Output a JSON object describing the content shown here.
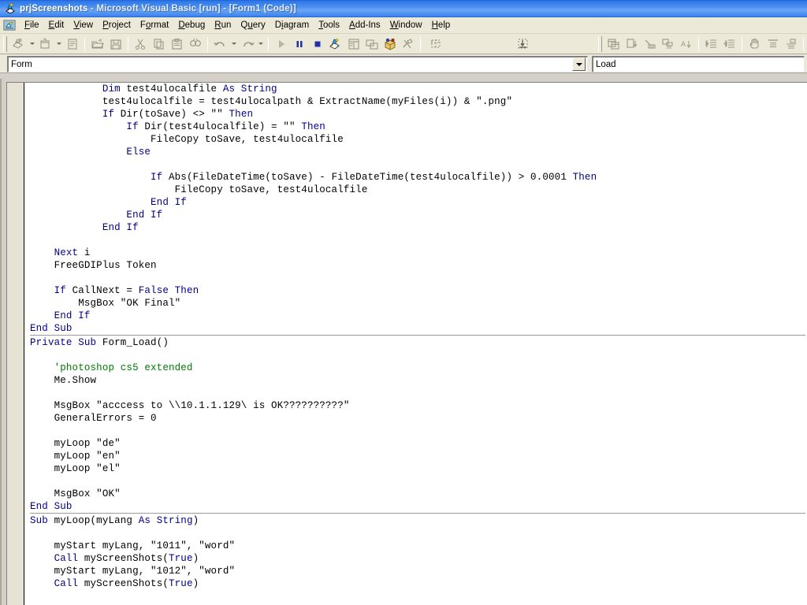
{
  "window": {
    "title_bold": "prjScreenshots",
    "title_rest": " - Microsoft Visual Basic [run] - [Form1 (Code)]",
    "app_icon": "vb-project-icon",
    "titlebar_color": "#3e86ee",
    "chrome_color": "#ece9d8"
  },
  "menu": {
    "doc_icon": "vb-document-icon",
    "items": [
      {
        "label": "File",
        "accel": "F"
      },
      {
        "label": "Edit",
        "accel": "E"
      },
      {
        "label": "View",
        "accel": "V"
      },
      {
        "label": "Project",
        "accel": "P"
      },
      {
        "label": "Format",
        "accel": "o"
      },
      {
        "label": "Debug",
        "accel": "D"
      },
      {
        "label": "Run",
        "accel": "R"
      },
      {
        "label": "Query",
        "accel": "u"
      },
      {
        "label": "Diagram",
        "accel": "i"
      },
      {
        "label": "Tools",
        "accel": "T"
      },
      {
        "label": "Add-Ins",
        "accel": "A"
      },
      {
        "label": "Window",
        "accel": "W"
      },
      {
        "label": "Help",
        "accel": "H"
      }
    ]
  },
  "toolbar": {
    "buttons": [
      {
        "name": "add-project-icon",
        "tip": "Add Project",
        "enabled": false,
        "split": true
      },
      {
        "name": "add-form-icon",
        "tip": "Add Form",
        "enabled": false,
        "split": true
      },
      {
        "name": "menu-editor-icon",
        "tip": "Menu Editor",
        "enabled": false,
        "split": false
      },
      {
        "name": "open-project-icon",
        "tip": "Open Project",
        "enabled": false,
        "split": false
      },
      {
        "name": "save-project-icon",
        "tip": "Save Project",
        "enabled": false,
        "split": false
      },
      {
        "name": "cut-icon",
        "tip": "Cut",
        "enabled": false,
        "split": false
      },
      {
        "name": "copy-icon",
        "tip": "Copy",
        "enabled": false,
        "split": false
      },
      {
        "name": "paste-icon",
        "tip": "Paste",
        "enabled": false,
        "split": false
      },
      {
        "name": "find-icon",
        "tip": "Find",
        "enabled": false,
        "split": false
      },
      {
        "name": "undo-icon",
        "tip": "Undo",
        "enabled": false,
        "split": false
      },
      {
        "name": "redo-icon",
        "tip": "Redo",
        "enabled": false,
        "split": false
      },
      {
        "name": "start-icon",
        "tip": "Start",
        "enabled": false,
        "split": false
      },
      {
        "name": "break-icon",
        "tip": "Break",
        "enabled": true,
        "split": false
      },
      {
        "name": "end-icon",
        "tip": "End",
        "enabled": true,
        "split": false
      },
      {
        "name": "project-explorer-icon",
        "tip": "Project Explorer",
        "enabled": true,
        "split": false
      },
      {
        "name": "properties-window-icon",
        "tip": "Properties Window",
        "enabled": false,
        "split": false
      },
      {
        "name": "form-layout-icon",
        "tip": "Form Layout Window",
        "enabled": false,
        "split": false
      },
      {
        "name": "object-browser-icon",
        "tip": "Object Browser",
        "enabled": true,
        "split": false
      },
      {
        "name": "toolbox-icon",
        "tip": "Toolbox",
        "enabled": true,
        "split": false
      },
      {
        "name": "data-view-icon",
        "tip": "Data View Window",
        "enabled": false,
        "split": false
      },
      {
        "name": "visual-component-icon",
        "tip": "Visual Component Manager",
        "enabled": false,
        "split": false
      }
    ],
    "right_buttons": [
      {
        "name": "new-query-icon",
        "tip": "New Query"
      },
      {
        "name": "run-query-icon",
        "tip": "Run Query"
      },
      {
        "name": "verify-sql-icon",
        "tip": "Verify SQL Syntax"
      },
      {
        "name": "group-by-icon",
        "tip": "Group By"
      },
      {
        "name": "sort-asc-icon",
        "tip": "Sort Ascending"
      },
      {
        "name": "indent-icon",
        "tip": "Indent"
      },
      {
        "name": "outdent-icon",
        "tip": "Outdent"
      },
      {
        "name": "hand-icon",
        "tip": "Pan"
      },
      {
        "name": "align-left-icon",
        "tip": "Align Left"
      },
      {
        "name": "align-top-icon",
        "tip": "Align Top"
      }
    ],
    "progress_indicator": "progress-markers"
  },
  "combos": {
    "object": {
      "value": "Form",
      "dropdown_icon": "chevron-down-icon"
    },
    "procedure": {
      "value": "Load"
    }
  },
  "code": {
    "lines": [
      {
        "indent": 12,
        "segments": [
          {
            "t": "Dim ",
            "c": "kw"
          },
          {
            "t": "test4ulocalfile "
          },
          {
            "t": "As String",
            "c": "kw"
          }
        ]
      },
      {
        "indent": 12,
        "segments": [
          {
            "t": "test4ulocalfile = test4ulocalpath & ExtractName(myFiles(i)) & \".png\""
          }
        ]
      },
      {
        "indent": 12,
        "segments": [
          {
            "t": "If ",
            "c": "kw"
          },
          {
            "t": "Dir(toSave) <> \"\" "
          },
          {
            "t": "Then",
            "c": "kw"
          }
        ]
      },
      {
        "indent": 16,
        "segments": [
          {
            "t": "If ",
            "c": "kw"
          },
          {
            "t": "Dir(test4ulocalfile) = \"\" "
          },
          {
            "t": "Then",
            "c": "kw"
          }
        ]
      },
      {
        "indent": 20,
        "segments": [
          {
            "t": "FileCopy toSave, test4ulocalfile"
          }
        ]
      },
      {
        "indent": 16,
        "segments": [
          {
            "t": "Else",
            "c": "kw"
          }
        ]
      },
      {
        "indent": 0,
        "segments": []
      },
      {
        "indent": 20,
        "segments": [
          {
            "t": "If ",
            "c": "kw"
          },
          {
            "t": "Abs(FileDateTime(toSave) - FileDateTime(test4ulocalfile)) > 0.0001 "
          },
          {
            "t": "Then",
            "c": "kw"
          }
        ]
      },
      {
        "indent": 24,
        "segments": [
          {
            "t": "FileCopy toSave, test4ulocalfile"
          }
        ]
      },
      {
        "indent": 20,
        "segments": [
          {
            "t": "End If",
            "c": "kw"
          }
        ]
      },
      {
        "indent": 16,
        "segments": [
          {
            "t": "End If",
            "c": "kw"
          }
        ]
      },
      {
        "indent": 12,
        "segments": [
          {
            "t": "End If",
            "c": "kw"
          }
        ]
      },
      {
        "indent": 0,
        "segments": []
      },
      {
        "indent": 4,
        "segments": [
          {
            "t": "Next ",
            "c": "kw"
          },
          {
            "t": "i"
          }
        ]
      },
      {
        "indent": 4,
        "segments": [
          {
            "t": "FreeGDIPlus Token"
          }
        ]
      },
      {
        "indent": 0,
        "segments": []
      },
      {
        "indent": 4,
        "segments": [
          {
            "t": "If ",
            "c": "kw"
          },
          {
            "t": "CallNext = "
          },
          {
            "t": "False Then",
            "c": "kw"
          }
        ]
      },
      {
        "indent": 8,
        "segments": [
          {
            "t": "MsgBox \"OK Final\""
          }
        ]
      },
      {
        "indent": 4,
        "segments": [
          {
            "t": "End If",
            "c": "kw"
          }
        ]
      },
      {
        "indent": 0,
        "segments": [
          {
            "t": "End Sub",
            "c": "kw"
          }
        ]
      },
      {
        "sep": true
      },
      {
        "indent": 0,
        "segments": [
          {
            "t": "Private Sub ",
            "c": "kw"
          },
          {
            "t": "Form_Load()"
          }
        ]
      },
      {
        "indent": 0,
        "segments": []
      },
      {
        "indent": 4,
        "segments": [
          {
            "t": "'photoshop cs5 extended",
            "c": "cmt"
          }
        ]
      },
      {
        "indent": 4,
        "segments": [
          {
            "t": "Me.Show"
          }
        ]
      },
      {
        "indent": 0,
        "segments": []
      },
      {
        "indent": 4,
        "segments": [
          {
            "t": "MsgBox \"acccess to \\\\10.1.1.129\\ is OK??????????\""
          }
        ]
      },
      {
        "indent": 4,
        "segments": [
          {
            "t": "GeneralErrors = 0"
          }
        ]
      },
      {
        "indent": 0,
        "segments": []
      },
      {
        "indent": 4,
        "segments": [
          {
            "t": "myLoop \"de\""
          }
        ]
      },
      {
        "indent": 4,
        "segments": [
          {
            "t": "myLoop \"en\""
          }
        ]
      },
      {
        "indent": 4,
        "segments": [
          {
            "t": "myLoop \"el\""
          }
        ]
      },
      {
        "indent": 0,
        "segments": []
      },
      {
        "indent": 4,
        "segments": [
          {
            "t": "MsgBox \"OK\""
          }
        ]
      },
      {
        "indent": 0,
        "segments": [
          {
            "t": "End Sub",
            "c": "kw"
          }
        ]
      },
      {
        "sep": true
      },
      {
        "indent": 0,
        "segments": [
          {
            "t": "Sub ",
            "c": "kw"
          },
          {
            "t": "myLoop(myLang "
          },
          {
            "t": "As String",
            "c": "kw"
          },
          {
            "t": ")"
          }
        ]
      },
      {
        "indent": 0,
        "segments": []
      },
      {
        "indent": 4,
        "segments": [
          {
            "t": "myStart myLang, \"1011\", \"word\""
          }
        ]
      },
      {
        "indent": 4,
        "segments": [
          {
            "t": "Call ",
            "c": "kw"
          },
          {
            "t": "myScreenShots("
          },
          {
            "t": "True",
            "c": "kw"
          },
          {
            "t": ")"
          }
        ]
      },
      {
        "indent": 4,
        "segments": [
          {
            "t": "myStart myLang, \"1012\", \"word\""
          }
        ]
      },
      {
        "indent": 4,
        "segments": [
          {
            "t": "Call ",
            "c": "kw"
          },
          {
            "t": "myScreenShots("
          },
          {
            "t": "True",
            "c": "kw"
          },
          {
            "t": ")"
          }
        ]
      }
    ]
  }
}
